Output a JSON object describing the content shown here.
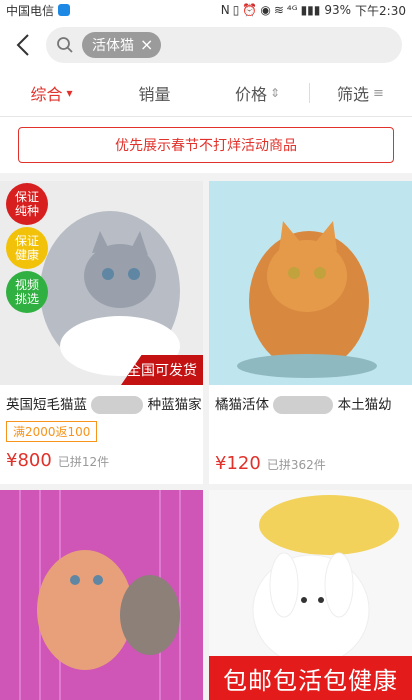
{
  "status": {
    "carrier": "中国电信",
    "battery": "93%",
    "time": "下午2:30",
    "icons": [
      "nfc-icon",
      "vibrate-icon",
      "alarm-icon",
      "eye-icon",
      "wifi-icon",
      "signal-4g-icon",
      "signal-icon"
    ]
  },
  "search": {
    "chip_text": "活体猫",
    "chip_close": "×"
  },
  "tabs": [
    {
      "label": "综合",
      "indicator": "▾"
    },
    {
      "label": "销量",
      "indicator": ""
    },
    {
      "label": "价格",
      "indicator": "⇕"
    },
    {
      "label": "筛选",
      "indicator": "≡"
    }
  ],
  "banner": "优先展示春节不打烊活动商品",
  "products": [
    {
      "title_left": "英国短毛猫蓝",
      "title_right": "种蓝猫家",
      "promo": "满2000返100",
      "currency": "¥",
      "price": "800",
      "sold": "已拼12件",
      "badges": [
        {
          "text": "保证\n纯种"
        },
        {
          "text": "保证\n健康"
        },
        {
          "text": "视频\n挑选"
        }
      ],
      "ribbon": "全国可发货"
    },
    {
      "title_left": "橘猫活体",
      "title_right": "本土猫幼",
      "currency": "¥",
      "price": "120",
      "sold": "已拼362件"
    },
    {},
    {
      "ribbon_bottom": "包邮包活包健康"
    }
  ],
  "colors": {
    "accent": "#e0322b",
    "promo": "#f7941d",
    "chip": "#9b9b9b"
  }
}
